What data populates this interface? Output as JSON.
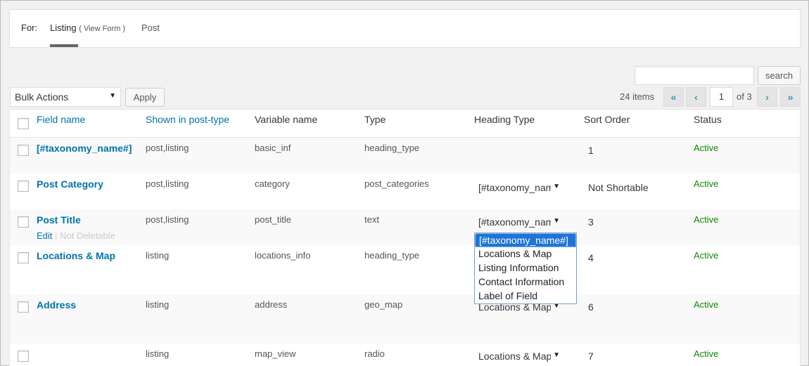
{
  "for_bar": {
    "for_label": "For:",
    "tab_listing": "Listing",
    "view_form_open": "(",
    "view_form": "View Form",
    "view_form_close": ")",
    "tab_post": "Post"
  },
  "search": {
    "placeholder": "",
    "button": "search"
  },
  "bulk": {
    "selected": "Bulk Actions",
    "apply": "Apply"
  },
  "pagination": {
    "items": "24 items",
    "first": "«",
    "prev": "‹",
    "current": "1",
    "of": "of 3",
    "next": "›",
    "last": "»"
  },
  "columns": {
    "field_name": "Field name",
    "shown_in": "Shown in post-type",
    "variable_name": "Variable name",
    "type": "Type",
    "heading_type": "Heading Type",
    "sort_order": "Sort Order",
    "status": "Status"
  },
  "rows": [
    {
      "name": "[#taxonomy_name#]",
      "post_types": "post,listing",
      "variable": "basic_inf",
      "type": "heading_type",
      "heading": "",
      "sort": "1",
      "status": "Active"
    },
    {
      "name": "Post Category",
      "post_types": "post,listing",
      "variable": "category",
      "type": "post_categories",
      "heading": "[#taxonomy_name#]",
      "sort": "Not Shortable",
      "status": "Active"
    },
    {
      "name": "Post Title",
      "post_types": "post,listing",
      "variable": "post_title",
      "type": "text",
      "heading": "[#taxonomy_name#]",
      "sort": "3",
      "status": "Active",
      "actions": {
        "edit": "Edit",
        "sep": "|",
        "not_deletable": "Not Deletable"
      }
    },
    {
      "name": "Locations & Map",
      "post_types": "listing",
      "variable": "locations_info",
      "type": "heading_type",
      "heading": "",
      "sort": "4",
      "status": "Active"
    },
    {
      "name": "Address",
      "post_types": "listing",
      "variable": "address",
      "type": "geo_map",
      "heading": "Locations & Map",
      "sort": "6",
      "status": "Active"
    },
    {
      "name": "",
      "post_types": "listing",
      "variable": "map_view",
      "type": "radio",
      "heading": "Locations & Map",
      "sort": "7",
      "status": "Active"
    }
  ],
  "dropdown_options": [
    "[#taxonomy_name#]",
    "Locations & Map",
    "Listing Information",
    "Contact Information",
    "Label of Field"
  ],
  "colors": {
    "link": "#0073aa",
    "status_active": "#0a8a00",
    "dropdown_highlight": "#1e74d7"
  },
  "icons": {
    "select_arrow": "▼"
  }
}
